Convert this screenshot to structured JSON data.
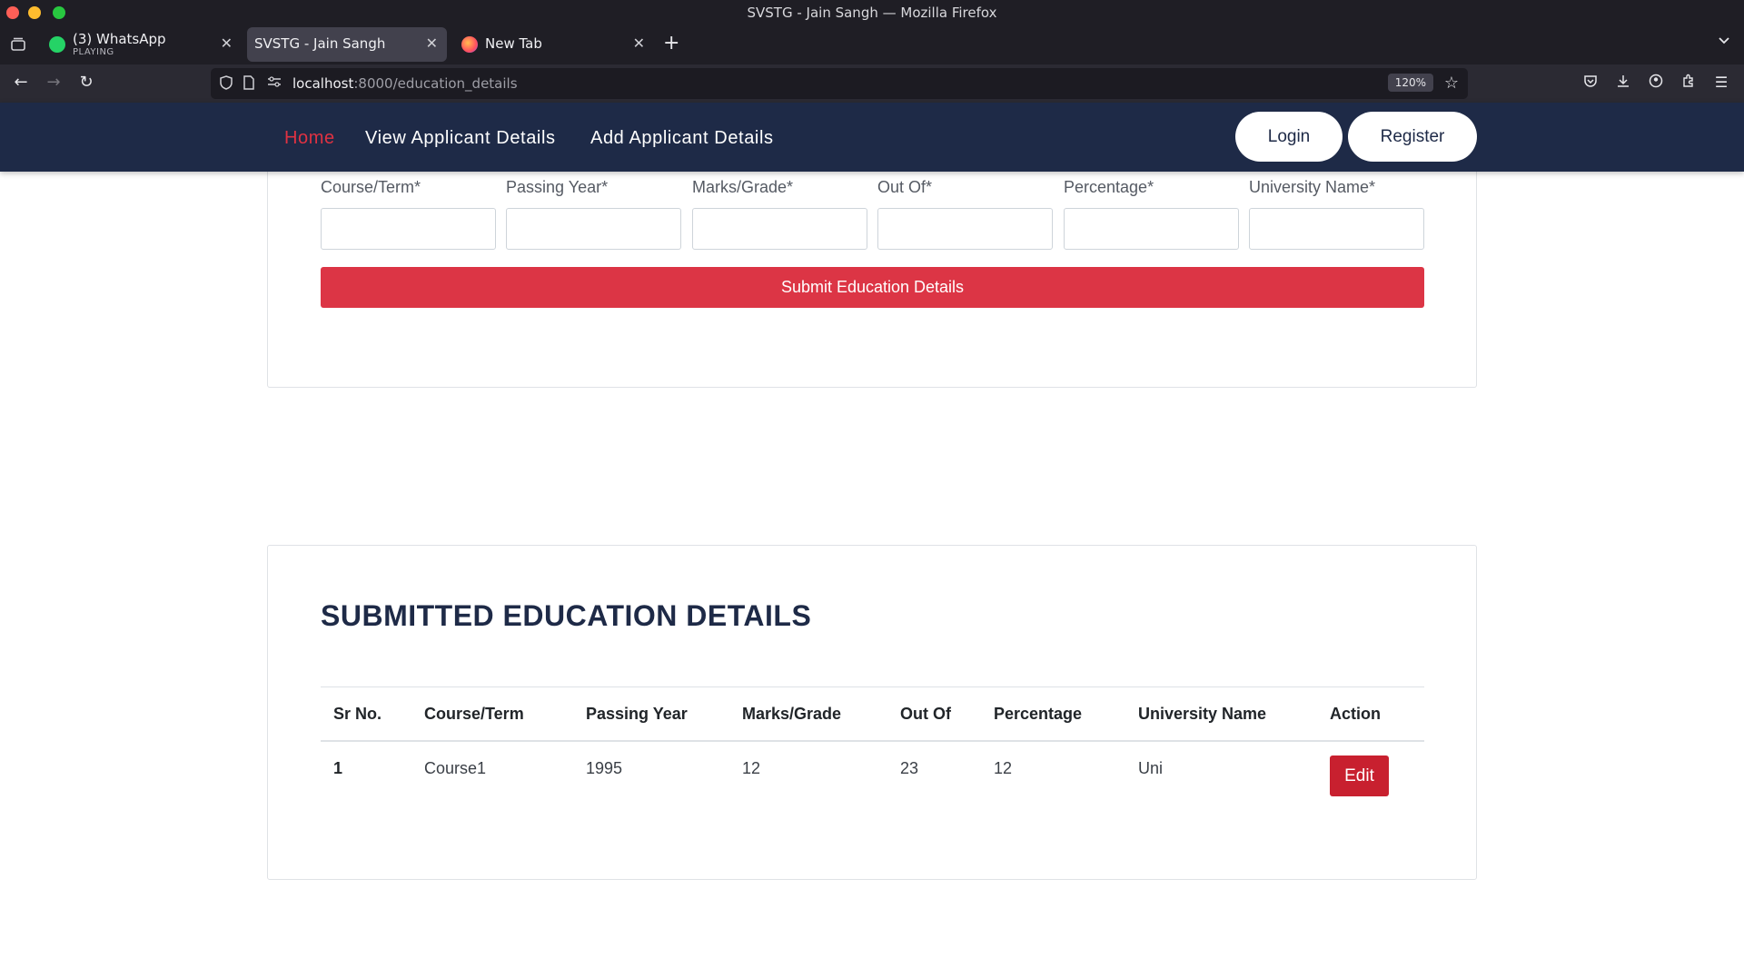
{
  "window": {
    "title": "SVSTG - Jain Sangh — Mozilla Firefox"
  },
  "tabs": [
    {
      "title": "(3) WhatsApp",
      "subtitle": "PLAYING",
      "active": false
    },
    {
      "title": "SVSTG - Jain Sangh",
      "active": true
    },
    {
      "title": "New Tab",
      "active": false
    }
  ],
  "urlbar": {
    "host": "localhost",
    "path": ":8000/education_details",
    "zoom": "120%"
  },
  "site_nav": {
    "home": "Home",
    "view": "View Applicant Details",
    "add": "Add Applicant Details",
    "login": "Login",
    "register": "Register"
  },
  "form": {
    "labels": [
      "Course/Term*",
      "Passing Year*",
      "Marks/Grade*",
      "Out Of*",
      "Percentage*",
      "University Name*"
    ],
    "values": [
      "",
      "",
      "",
      "",
      "",
      ""
    ],
    "submit_label": "Submit Education Details"
  },
  "submitted": {
    "title": "SUBMITTED EDUCATION DETAILS",
    "headers": [
      "Sr No.",
      "Course/Term",
      "Passing Year",
      "Marks/Grade",
      "Out Of",
      "Percentage",
      "University Name",
      "Action"
    ],
    "rows": [
      {
        "sr": "1",
        "course": "Course1",
        "year": "1995",
        "marks": "12",
        "out_of": "23",
        "percentage": "12",
        "university": "Uni",
        "action": "Edit"
      }
    ]
  },
  "colors": {
    "header_bg": "#1e2a47",
    "accent_red": "#dc3545",
    "home_link": "#e03242"
  }
}
